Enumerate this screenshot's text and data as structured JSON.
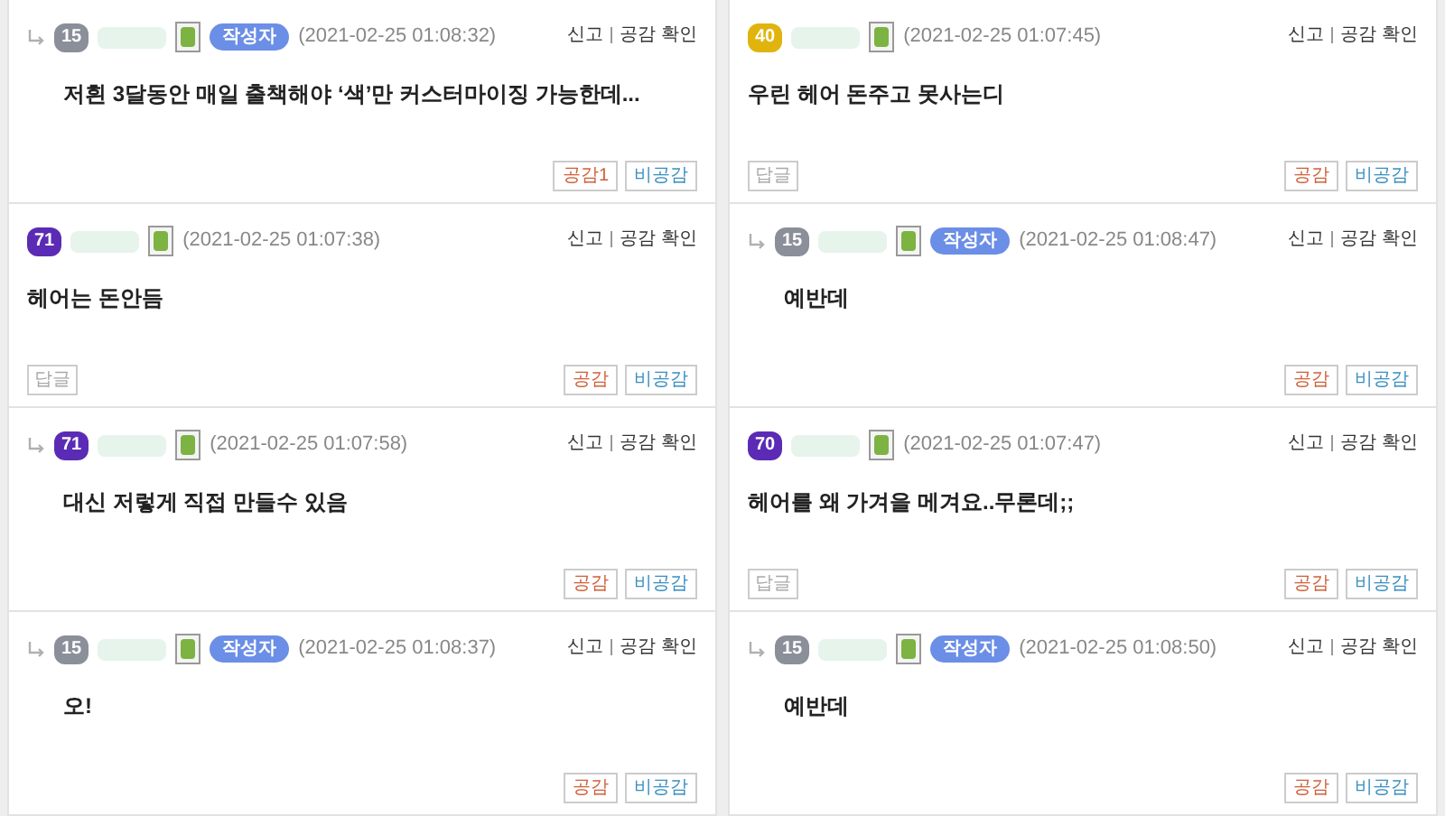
{
  "columns": [
    {
      "comments": [
        {
          "is_reply": true,
          "level": "15",
          "color": "#8a8f99",
          "author_tag": "작성자",
          "time": "(2021-02-25 01:08:32)",
          "report": "신고",
          "check": "공감 확인",
          "text": "저흰 3달동안 매일 출책해야 ‘색’만 커스터마이징 가능한데...",
          "like": "공감1",
          "dislike": "비공감"
        },
        {
          "is_reply": false,
          "level": "71",
          "color": "#5b2bb5",
          "time": "(2021-02-25 01:07:38)",
          "report": "신고",
          "check": "공감 확인",
          "text": "헤어는 돈안듬",
          "reply_button": "답글",
          "like": "공감",
          "dislike": "비공감"
        },
        {
          "is_reply": true,
          "level": "71",
          "color": "#5b2bb5",
          "time": "(2021-02-25 01:07:58)",
          "report": "신고",
          "check": "공감 확인",
          "text": "대신 저렇게 직접 만들수 있음",
          "like": "공감",
          "dislike": "비공감"
        },
        {
          "is_reply": true,
          "level": "15",
          "color": "#8a8f99",
          "author_tag": "작성자",
          "time": "(2021-02-25 01:08:37)",
          "report": "신고",
          "check": "공감 확인",
          "text": "오!",
          "like": "공감",
          "dislike": "비공감"
        }
      ]
    },
    {
      "comments": [
        {
          "is_reply": false,
          "level": "40",
          "color": "#e0b40c",
          "time": "(2021-02-25 01:07:45)",
          "report": "신고",
          "check": "공감 확인",
          "text": "우린 헤어 돈주고 못사는디",
          "reply_button": "답글",
          "like": "공감",
          "dislike": "비공감"
        },
        {
          "is_reply": true,
          "level": "15",
          "color": "#8a8f99",
          "author_tag": "작성자",
          "time": "(2021-02-25 01:08:47)",
          "report": "신고",
          "check": "공감 확인",
          "text": "예반데",
          "like": "공감",
          "dislike": "비공감"
        },
        {
          "is_reply": false,
          "level": "70",
          "color": "#5b2bb5",
          "time": "(2021-02-25 01:07:47)",
          "report": "신고",
          "check": "공감 확인",
          "text": "헤어를 왜 가겨을 메겨요..무론데;;",
          "reply_button": "답글",
          "like": "공감",
          "dislike": "비공감"
        },
        {
          "is_reply": true,
          "level": "15",
          "color": "#8a8f99",
          "author_tag": "작성자",
          "time": "(2021-02-25 01:08:50)",
          "report": "신고",
          "check": "공감 확인",
          "text": "예반데",
          "like": "공감",
          "dislike": "비공감"
        }
      ]
    }
  ]
}
